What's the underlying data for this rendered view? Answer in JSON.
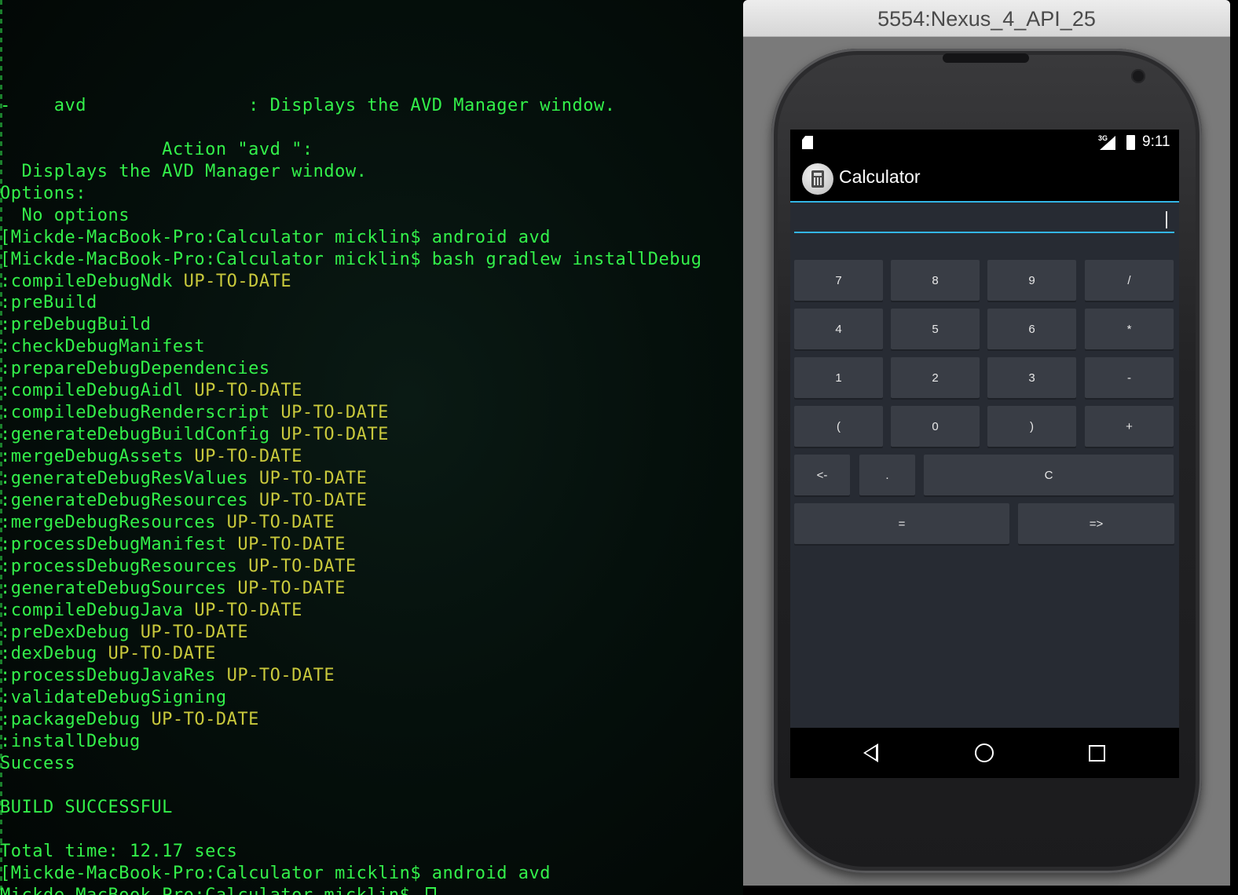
{
  "terminal": {
    "lines": [
      {
        "text": "-    avd               : Displays the AVD Manager window.",
        "status": ""
      },
      {
        "text": "",
        "status": ""
      },
      {
        "text": "               Action \"avd \":",
        "status": ""
      },
      {
        "text": "  Displays the AVD Manager window.",
        "status": ""
      },
      {
        "text": "Options:",
        "status": ""
      },
      {
        "text": "  No options",
        "status": ""
      },
      {
        "text": "[Mickde-MacBook-Pro:Calculator micklin$ android avd",
        "status": ""
      },
      {
        "text": "[Mickde-MacBook-Pro:Calculator micklin$ bash gradlew installDebug",
        "status": ""
      },
      {
        "text": ":compileDebugNdk ",
        "status": "UP-TO-DATE"
      },
      {
        "text": ":preBuild",
        "status": ""
      },
      {
        "text": ":preDebugBuild",
        "status": ""
      },
      {
        "text": ":checkDebugManifest",
        "status": ""
      },
      {
        "text": ":prepareDebugDependencies",
        "status": ""
      },
      {
        "text": ":compileDebugAidl ",
        "status": "UP-TO-DATE"
      },
      {
        "text": ":compileDebugRenderscript ",
        "status": "UP-TO-DATE"
      },
      {
        "text": ":generateDebugBuildConfig ",
        "status": "UP-TO-DATE"
      },
      {
        "text": ":mergeDebugAssets ",
        "status": "UP-TO-DATE"
      },
      {
        "text": ":generateDebugResValues ",
        "status": "UP-TO-DATE"
      },
      {
        "text": ":generateDebugResources ",
        "status": "UP-TO-DATE"
      },
      {
        "text": ":mergeDebugResources ",
        "status": "UP-TO-DATE"
      },
      {
        "text": ":processDebugManifest ",
        "status": "UP-TO-DATE"
      },
      {
        "text": ":processDebugResources ",
        "status": "UP-TO-DATE"
      },
      {
        "text": ":generateDebugSources ",
        "status": "UP-TO-DATE"
      },
      {
        "text": ":compileDebugJava ",
        "status": "UP-TO-DATE"
      },
      {
        "text": ":preDexDebug ",
        "status": "UP-TO-DATE"
      },
      {
        "text": ":dexDebug ",
        "status": "UP-TO-DATE"
      },
      {
        "text": ":processDebugJavaRes ",
        "status": "UP-TO-DATE"
      },
      {
        "text": ":validateDebugSigning",
        "status": ""
      },
      {
        "text": ":packageDebug ",
        "status": "UP-TO-DATE"
      },
      {
        "text": ":installDebug",
        "status": ""
      },
      {
        "text": "Success",
        "status": ""
      },
      {
        "text": "",
        "status": ""
      },
      {
        "text": "BUILD SUCCESSFUL",
        "status": ""
      },
      {
        "text": "",
        "status": ""
      },
      {
        "text": "Total time: 12.17 secs",
        "status": ""
      },
      {
        "text": "[Mickde-MacBook-Pro:Calculator micklin$ android avd",
        "status": ""
      },
      {
        "text": "Mickde-MacBook-Pro:Calculator micklin$ ",
        "status": "",
        "cursor": true
      }
    ]
  },
  "emulator": {
    "title": "5554:Nexus_4_API_25",
    "status_bar": {
      "network": "3G",
      "time": "9:11"
    },
    "app": {
      "title": "Calculator",
      "display_value": "",
      "keys": [
        "7",
        "8",
        "9",
        "/",
        "4",
        "5",
        "6",
        "*",
        "1",
        "2",
        "3",
        "-",
        "(",
        "0",
        ")",
        "+",
        "<-",
        ".",
        "C",
        "=",
        "=>"
      ]
    },
    "nav": [
      "back-icon",
      "home-icon",
      "recents-icon"
    ]
  },
  "colors": {
    "terminal_text": "#33f04a",
    "status_text": "#c9c93c",
    "accent": "#33b5e5"
  }
}
